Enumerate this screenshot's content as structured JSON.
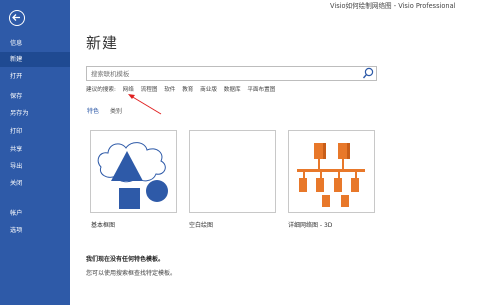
{
  "window": {
    "title": "Visio如何绘制网络图 - Visio Professional"
  },
  "sidebar": {
    "items": [
      {
        "label": "信息"
      },
      {
        "label": "新建"
      },
      {
        "label": "打开"
      },
      {
        "label": "保存"
      },
      {
        "label": "另存为"
      },
      {
        "label": "打印"
      },
      {
        "label": "共享"
      },
      {
        "label": "导出"
      },
      {
        "label": "关闭"
      },
      {
        "label": "帐户"
      },
      {
        "label": "选项"
      }
    ],
    "active_index": 1,
    "back_icon": "back-arrow-icon",
    "color": "#2e5aa8"
  },
  "main": {
    "title": "新建",
    "search": {
      "placeholder": "搜索联机模板",
      "value": ""
    },
    "suggested": {
      "label": "建议的搜索:",
      "links": [
        "网络",
        "流程图",
        "软件",
        "教育",
        "商业版",
        "数据库",
        "平面布置图"
      ]
    },
    "tabs": [
      {
        "label": "特色"
      },
      {
        "label": "类别"
      }
    ],
    "templates": [
      {
        "label": "基本框图"
      },
      {
        "label": "空白绘图"
      },
      {
        "label": "详细网络图 - 3D"
      }
    ],
    "info": {
      "line1": "我们现在没有任何特色模板。",
      "line2": "您可以使用搜索框查找特定模板。"
    }
  },
  "colors": {
    "accent": "#2e5aa8",
    "annotation": "#e02020",
    "shape_blue": "#2e5aa8",
    "server_orange": "#e8782a"
  }
}
